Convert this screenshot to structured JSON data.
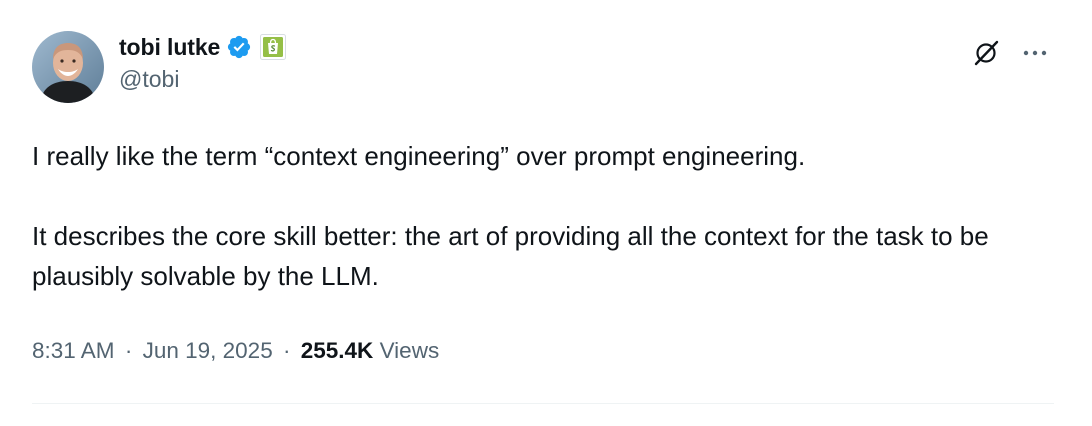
{
  "author": {
    "display_name": "tobi lutke",
    "handle": "@tobi"
  },
  "tweet": {
    "paragraph_1": "I really like the term “context engineering” over prompt engineering.",
    "paragraph_2": "It describes the core skill better: the art of providing all the context for the task to be plausibly solvable by the LLM."
  },
  "meta": {
    "time": "8:31 AM",
    "separator": "·",
    "date": "Jun 19, 2025",
    "view_count": "255.4K",
    "views_label": "Views"
  },
  "icons": {
    "verified": "verified-badge-icon",
    "affiliate": "shopify-bag-icon",
    "grok": "grok-icon",
    "more": "more-horizontal-icon"
  },
  "colors": {
    "text_primary": "#0f1419",
    "text_secondary": "#536471",
    "verified_blue": "#1d9bf0",
    "shopify_green": "#95bf47",
    "divider": "#eff3f4"
  }
}
